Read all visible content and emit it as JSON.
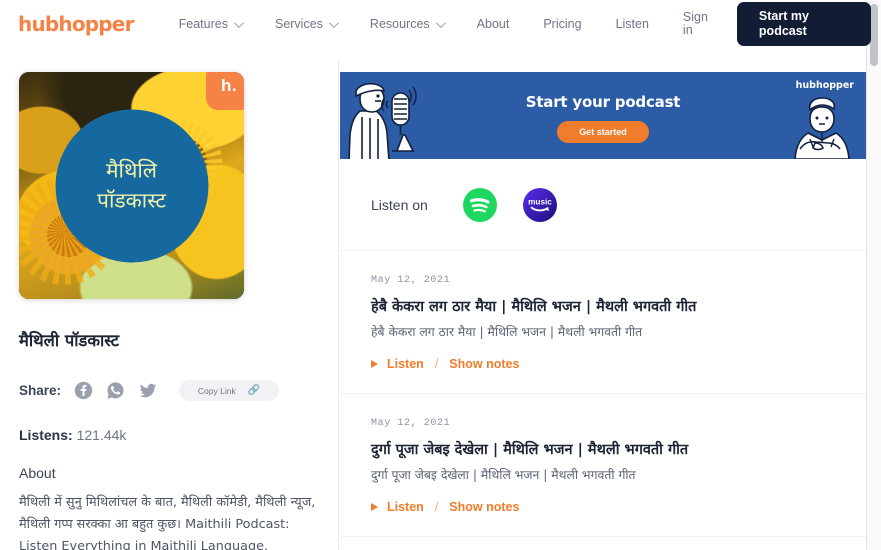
{
  "site": {
    "brand": "hubhopper",
    "colors": {
      "accent_orange": "#f58345",
      "link_orange": "#f07c2c",
      "dark_navy": "#131c35",
      "banner_blue": "#2d5ca6",
      "cover_circle_blue": "#16699e",
      "spotify_green": "#1ed760",
      "amazon_music_purple": "#4b19c8"
    }
  },
  "nav": {
    "items": [
      {
        "label": "Features",
        "has_dropdown": true
      },
      {
        "label": "Services",
        "has_dropdown": true
      },
      {
        "label": "Resources",
        "has_dropdown": true
      },
      {
        "label": "About",
        "has_dropdown": false
      },
      {
        "label": "Pricing",
        "has_dropdown": false
      },
      {
        "label": "Listen",
        "has_dropdown": false
      },
      {
        "label": "Sign in",
        "has_dropdown": false
      }
    ],
    "cta_label": "Start my podcast"
  },
  "sidebar": {
    "cover": {
      "badge_text": "h.",
      "circle_line1": "मैथिलि",
      "circle_line2": "पॉडकास्ट",
      "alt": "sunflower-cover-art"
    },
    "podcast_title": "मैथिली पॉडकास्ट",
    "share": {
      "label": "Share:",
      "networks": [
        "facebook-icon",
        "whatsapp-icon",
        "twitter-icon"
      ],
      "copy_link_label": "Copy Link",
      "copy_link_icon": "link-icon"
    },
    "listens_label": "Listens:",
    "listens_value": "121.44k",
    "about_heading": "About",
    "about_text": "मैथिली में सुनु मिथिलांचल के बात, मैथिली कॉमेडी, मैथिली न्यूज, मैथिली गप्प सरक्का आ बहुत कुछ। Maithili Podcast: Listen Everything in Maithili Language."
  },
  "promo": {
    "title": "Start your podcast",
    "button_label": "Get started",
    "logo": "hubhopper",
    "left_illustration": "person-singing-into-microphone",
    "right_illustration": "person-arms-crossed"
  },
  "listen_on": {
    "label": "Listen on",
    "platforms": [
      {
        "name": "spotify-icon",
        "label": "Spotify"
      },
      {
        "name": "amazon-music-icon",
        "label": "music"
      }
    ]
  },
  "episodes": [
    {
      "date": "May 12, 2021",
      "title": "हेबै केकरा लग ठार मैया | मैथिलि भजन | मैथली भगवती गीत",
      "subtitle": "हेबै केकरा लग ठार मैया | मैथिलि भजन | मैथली भगवती गीत",
      "listen_label": "Listen",
      "separator": "/",
      "notes_label": "Show notes"
    },
    {
      "date": "May 12, 2021",
      "title": "दुर्गा पूजा जेबइ देखेला | मैथिलि भजन | मैथली भगवती गीत",
      "subtitle": "दुर्गा पूजा जेबइ देखेला | मैथिलि भजन | मैथली भगवती गीत",
      "listen_label": "Listen",
      "separator": "/",
      "notes_label": "Show notes"
    }
  ]
}
